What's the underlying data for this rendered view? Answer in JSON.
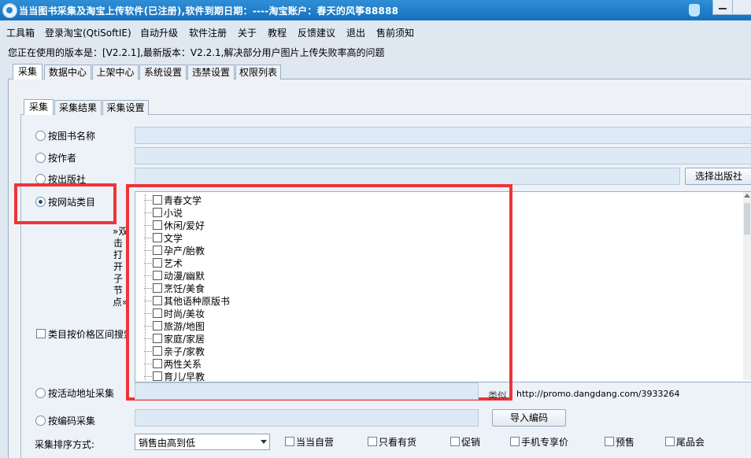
{
  "title_bar": {
    "title": "当当图书采集及淘宝上传软件(已注册),软件到期日期：----淘宝账户：春天的风筝88888"
  },
  "menu": [
    "工具箱",
    "登录淘宝(QtiSoftIE)",
    "自动升级",
    "软件注册",
    "关于",
    "教程",
    "反馈建议",
    "退出",
    "售前须知"
  ],
  "version_line": "您正在使用的版本是：[V2.2.1],最新版本：V2.2.1,解决部分用户图片上传失败率高的问题",
  "main_tabs": [
    "采集",
    "数据中心",
    "上架中心",
    "系统设置",
    "违禁设置",
    "权限列表"
  ],
  "sub_tabs": [
    "采集",
    "采集结果",
    "采集设置"
  ],
  "options": {
    "by_name": "按图书名称",
    "by_author": "按作者",
    "by_publisher": "按出版社",
    "select_publisher_button": "选择出版社",
    "by_category": "按网站类目",
    "double_click_hint": "»双击打开子节点»",
    "price_range_search": "类目按价格区间搜索",
    "by_activity_url": "按活动地址采集",
    "example_prefix": "类似",
    "example_url": "http://promo.dangdang.com/3933264",
    "by_code": "按编码采集",
    "import_code_button": "导入编码",
    "sort_label": "采集排序方式:",
    "sort_value": "销售由高到低"
  },
  "categories": [
    "青春文学",
    "小说",
    "休闲/爱好",
    "文学",
    "孕产/胎教",
    "艺术",
    "动漫/幽默",
    "烹饪/美食",
    "其他语种原版书",
    "时尚/美妆",
    "旅游/地图",
    "家庭/家居",
    "亲子/家教",
    "两性关系",
    "育儿/早教"
  ],
  "filters": [
    "当当自营",
    "只看有货",
    "促销",
    "手机专享价",
    "预售",
    "尾品会"
  ],
  "colors": {
    "title_bar": "#1570bd",
    "highlight": "#ee3438",
    "background": "#dfe7f1"
  }
}
